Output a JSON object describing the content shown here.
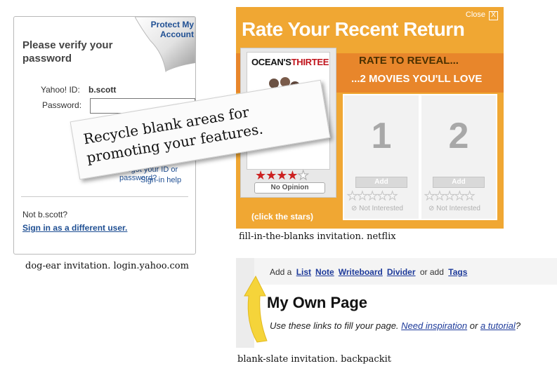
{
  "yahoo": {
    "title": "Please verify your password",
    "protect": "Protect My Account",
    "id_label": "Yahoo! ID:",
    "id_value": "b.scott",
    "password_label": "Password:",
    "forgot": "Forgot your ID or password?",
    "signin_help": "Sign-in help",
    "not_user": "Not b.scott?",
    "different_user": "Sign in as a different user.",
    "caption": "dog-ear invitation. login.yahoo.com"
  },
  "netflix": {
    "close": "Close",
    "close_x": "X",
    "headline": "Rate Your Recent Return",
    "poster_title_a": "OCEAN'S",
    "poster_title_b": "THIRTEEN",
    "no_opinion": "No Opinion",
    "click_stars": "(click the stars)",
    "rate_to_reveal": "RATE TO REVEAL...",
    "movies_love": "...2 MOVIES YOU'LL LOVE",
    "slot1_number": "1",
    "slot2_number": "2",
    "add": "Add",
    "not_interested": "Not Interested",
    "caption": "fill-in-the-blanks invitation. netflix",
    "rating": {
      "value": 4,
      "max": 5
    }
  },
  "note": {
    "text": "Recycle blank areas for promoting your features."
  },
  "backpack": {
    "add_a": "Add a",
    "links": [
      "List",
      "Note",
      "Writeboard",
      "Divider"
    ],
    "or_add": "or add",
    "tags": "Tags",
    "page_title": "My Own Page",
    "hint_prefix": "Use these links to fill your page.",
    "need_inspiration": "Need inspiration",
    "or": "or",
    "a_tutorial": "a tutorial",
    "question": "?",
    "caption": "blank-slate invitation. backpackit"
  },
  "colors": {
    "netflix_orange": "#f0a733",
    "netflix_dark_orange": "#e8862b",
    "yahoo_link": "#1f4f93",
    "backpack_link": "#1d3a9a",
    "arrow_yellow": "#f5d43a"
  }
}
